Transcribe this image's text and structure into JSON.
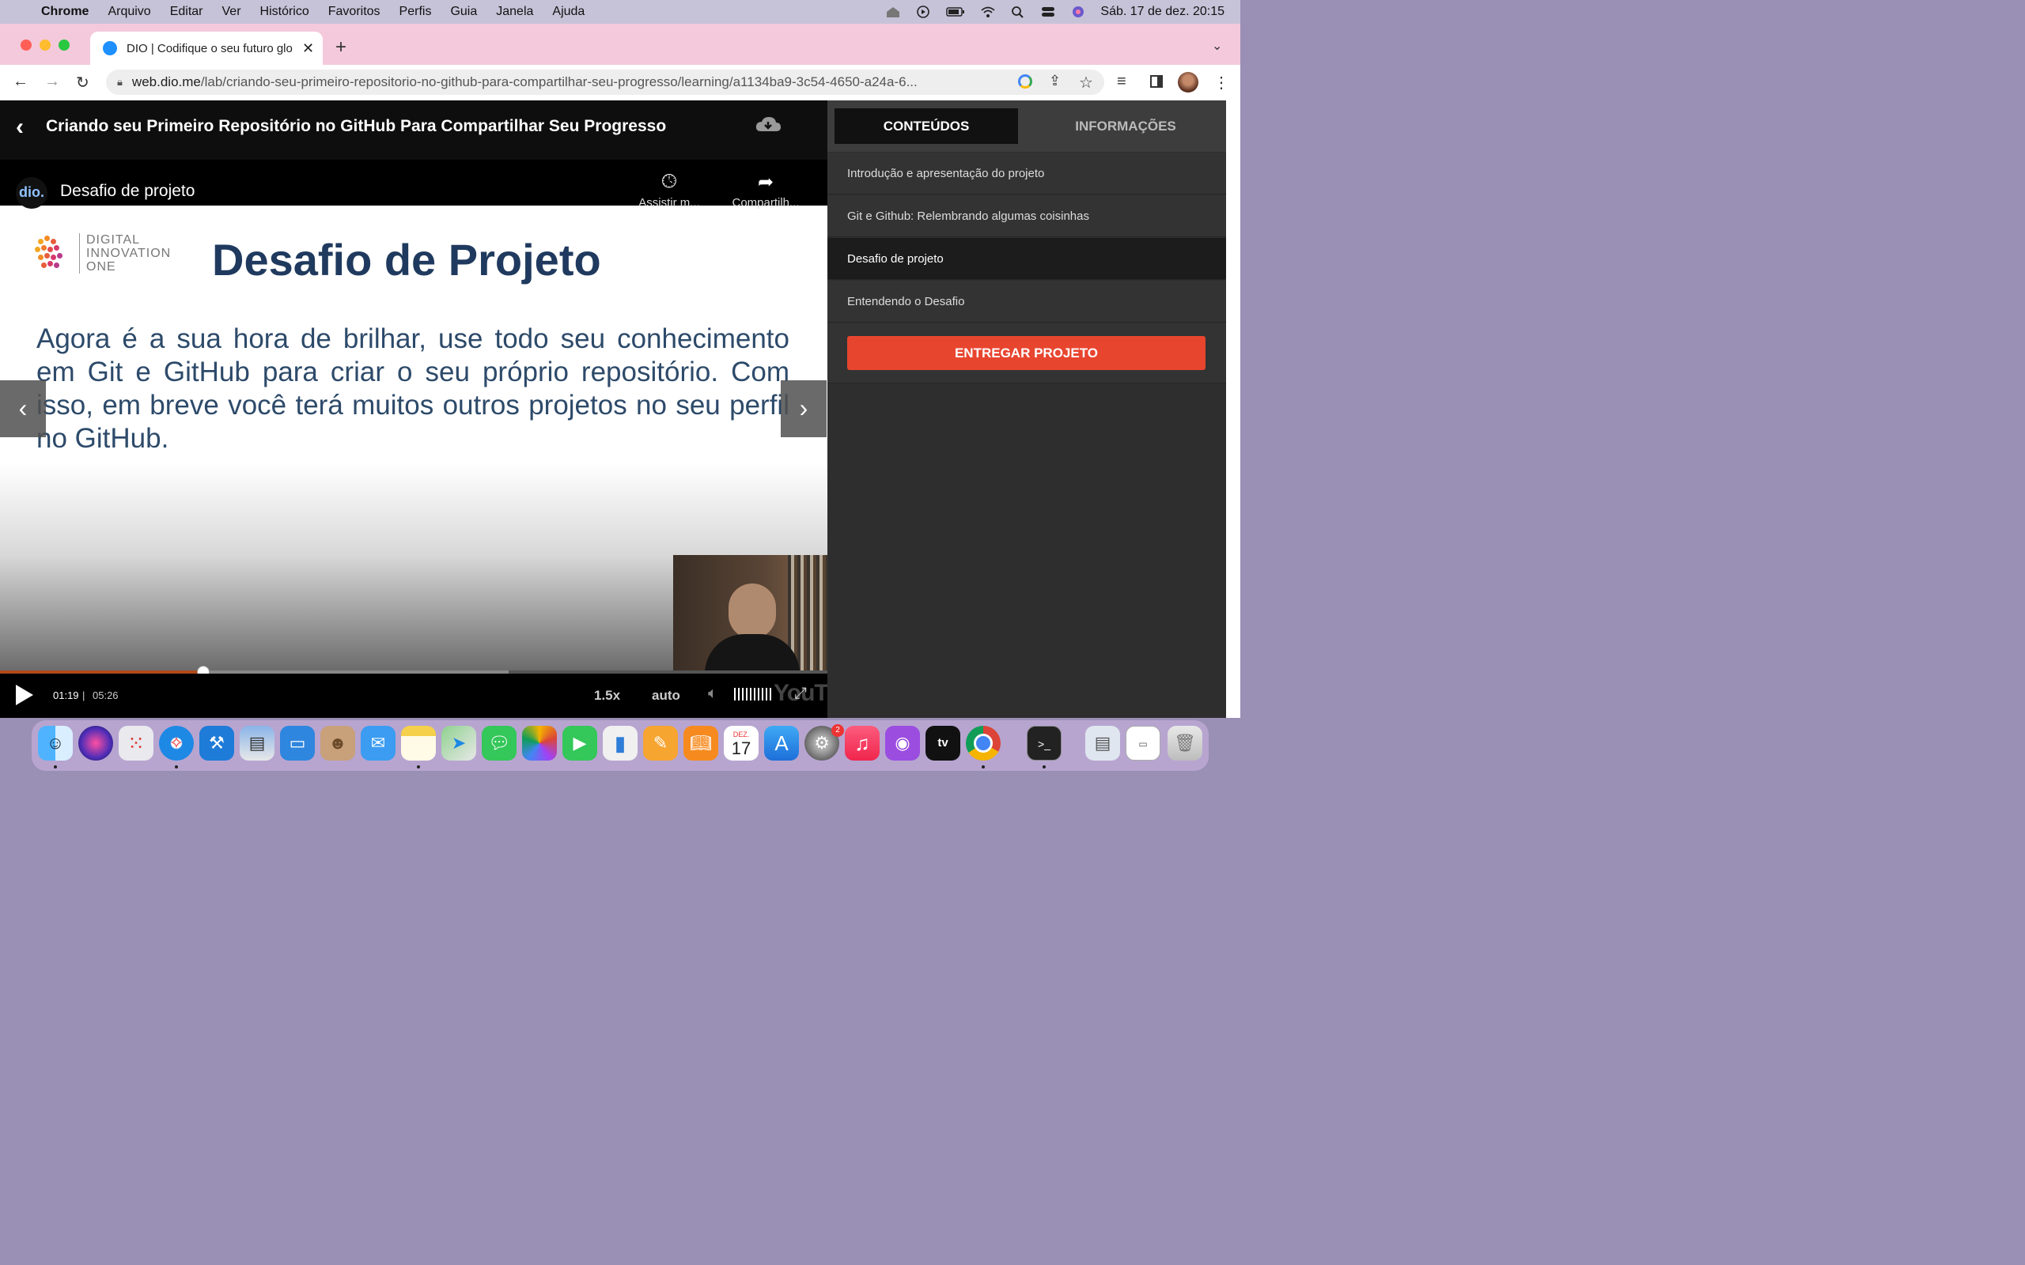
{
  "menubar": {
    "app": "Chrome",
    "items": [
      "Arquivo",
      "Editar",
      "Ver",
      "Histórico",
      "Favoritos",
      "Perfis",
      "Guia",
      "Janela",
      "Ajuda"
    ],
    "clock": "Sáb. 17 de dez.  20:15"
  },
  "browser": {
    "tab_title": "DIO | Codifique o seu futuro glo",
    "url_host": "web.dio.me",
    "url_path": "/lab/criando-seu-primeiro-repositorio-no-github-para-compartilhar-seu-progresso/learning/a1134ba9-3c54-4650-a24a-6..."
  },
  "course": {
    "title": "Criando seu Primeiro Repositório no GitHub Para Compartilhar Seu Progresso"
  },
  "video": {
    "channel_logo": "dio.",
    "title": "Desafio de projeto",
    "watch_later": "Assistir m...",
    "share": "Compartilh...",
    "slide": {
      "logo_lines": [
        "DIGITAL",
        "INNOVATION",
        "ONE"
      ],
      "heading": "Desafio de Projeto",
      "body": "Agora é a sua hora de brilhar, use todo seu conhecimento em Git e GitHub para criar o seu próprio repositório. Com isso, em breve você terá muitos outros projetos no seu perfil no GitHub."
    },
    "current_time": "01:19",
    "separator": "|",
    "duration": "05:26",
    "progress": 0.245,
    "buffered": 0.615,
    "speed": "1.5x",
    "quality": "auto",
    "youtube": "YouTube"
  },
  "sidebar": {
    "tabs": [
      "CONTEÚDOS",
      "INFORMAÇÕES"
    ],
    "lessons": [
      {
        "label": "Introdução e apresentação do projeto",
        "active": false
      },
      {
        "label": "Git e Github: Relembrando algumas coisinhas",
        "active": false
      },
      {
        "label": "Desafio de projeto",
        "active": true
      },
      {
        "label": "Entendendo o Desafio",
        "active": false
      }
    ],
    "submit": "ENTREGAR PROJETO"
  },
  "dock": {
    "calendar_month": "DEZ.",
    "calendar_day": "17",
    "settings_badge": "2",
    "tv": "tv"
  },
  "colors": {
    "accent": "#e8452f",
    "progress": "#b24a1c",
    "slide_heading": "#1f3a5e"
  }
}
